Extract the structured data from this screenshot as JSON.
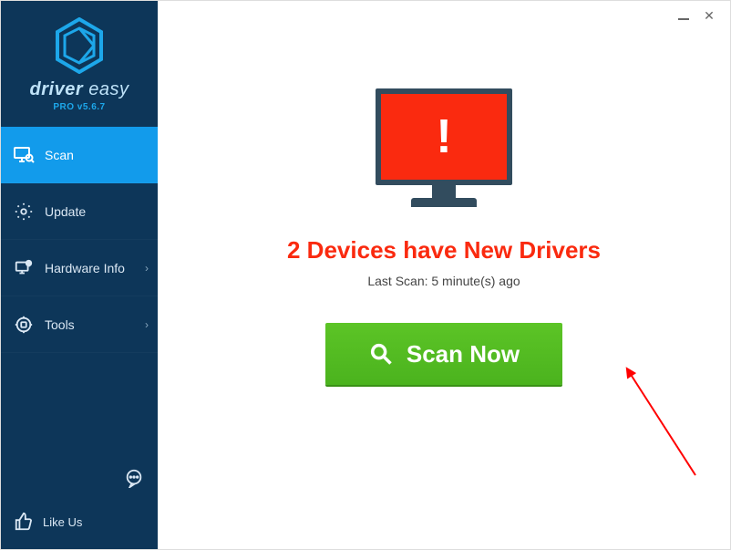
{
  "brand": {
    "name": "driver easy",
    "version": "PRO v5.6.7"
  },
  "sidebar": {
    "items": [
      {
        "label": "Scan"
      },
      {
        "label": "Update"
      },
      {
        "label": "Hardware Info"
      },
      {
        "label": "Tools"
      }
    ],
    "like": "Like Us"
  },
  "main": {
    "status_heading": "2 Devices have New Drivers",
    "last_scan": "Last Scan: 5 minute(s) ago",
    "scan_button_label": "Scan Now"
  },
  "colors": {
    "sidebar_bg": "#0d3659",
    "accent": "#129beb",
    "alert": "#fa2a0f",
    "scan_green": "#4bb31e"
  }
}
